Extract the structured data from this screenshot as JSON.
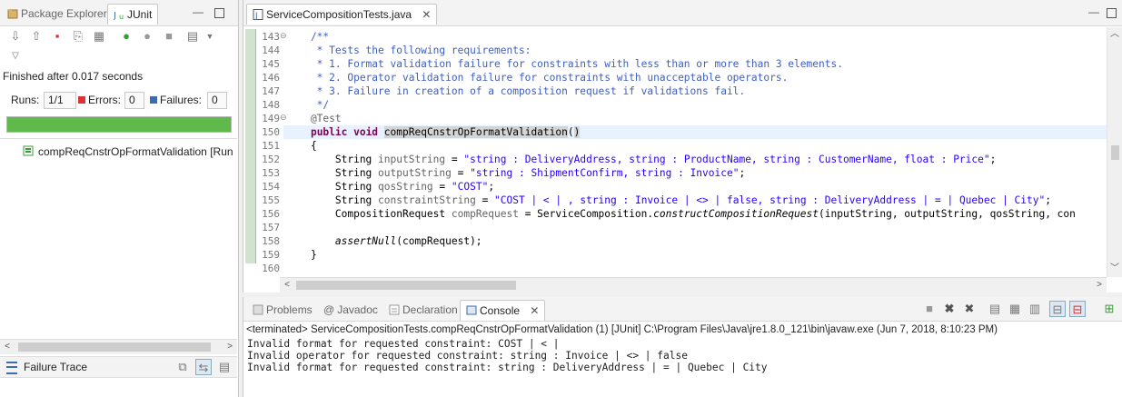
{
  "left_view": {
    "tabs": [
      {
        "label": "Package Explorer",
        "icon": "package-explorer-icon"
      },
      {
        "label": "JUnit",
        "icon": "junit-icon",
        "active": true
      }
    ],
    "status": "Finished after 0.017 seconds",
    "counters": {
      "runs_label": "Runs:",
      "runs_value": "1/1",
      "errors_label": "Errors:",
      "errors_value": "0",
      "failures_label": "Failures:",
      "failures_value": "0"
    },
    "progress": 1.0,
    "progress_color": "#5fba4b",
    "test_item": "compReqCnstrOpFormatValidation [Run",
    "failure_trace_label": "Failure Trace"
  },
  "editor": {
    "tab_label": "ServiceCompositionTests.java",
    "lines": [
      {
        "n": "143",
        "fold": "⊖",
        "parts": [
          {
            "t": "    /**",
            "c": "cmt"
          }
        ]
      },
      {
        "n": "144",
        "parts": [
          {
            "t": "     * Tests the following requirements:",
            "c": "cmt"
          }
        ]
      },
      {
        "n": "145",
        "parts": [
          {
            "t": "     * 1. Format validation failure for constraints with less than or more than 3 elements.",
            "c": "cmt"
          }
        ]
      },
      {
        "n": "146",
        "parts": [
          {
            "t": "     * 2. Operator validation failure for constraints with unacceptable operators.",
            "c": "cmt"
          }
        ]
      },
      {
        "n": "147",
        "parts": [
          {
            "t": "     * 3. Failure in creation of a composition request if validations fail.",
            "c": "cmt"
          }
        ]
      },
      {
        "n": "148",
        "parts": [
          {
            "t": "     */",
            "c": "cmt"
          }
        ]
      },
      {
        "n": "149",
        "fold": "⊖",
        "parts": [
          {
            "t": "    @Test",
            "c": "ann"
          }
        ]
      },
      {
        "n": "150",
        "current": true,
        "parts": [
          {
            "t": "    "
          },
          {
            "t": "public void",
            "c": "kw"
          },
          {
            "t": " "
          },
          {
            "t": "compReqCnstrOpFormatValidation",
            "c": "sel"
          },
          {
            "t": "("
          },
          {
            "t": ")",
            "c": "sel"
          }
        ]
      },
      {
        "n": "151",
        "parts": [
          {
            "t": "    {"
          }
        ]
      },
      {
        "n": "152",
        "parts": [
          {
            "t": "        String "
          },
          {
            "t": "inputString",
            "c": "ann"
          },
          {
            "t": " = "
          },
          {
            "t": "\"string : DeliveryAddress, string : ProductName, string : CustomerName, float : Price\"",
            "c": "str"
          },
          {
            "t": ";"
          }
        ]
      },
      {
        "n": "153",
        "parts": [
          {
            "t": "        String "
          },
          {
            "t": "outputString",
            "c": "ann"
          },
          {
            "t": " = "
          },
          {
            "t": "\"string : ShipmentConfirm, string : Invoice\"",
            "c": "str"
          },
          {
            "t": ";"
          }
        ]
      },
      {
        "n": "154",
        "parts": [
          {
            "t": "        String "
          },
          {
            "t": "qosString",
            "c": "ann"
          },
          {
            "t": " = "
          },
          {
            "t": "\"COST\"",
            "c": "str"
          },
          {
            "t": ";"
          }
        ]
      },
      {
        "n": "155",
        "parts": [
          {
            "t": "        String "
          },
          {
            "t": "constraintString",
            "c": "ann"
          },
          {
            "t": " = "
          },
          {
            "t": "\"COST | < | , string : Invoice | <> | false, string : DeliveryAddress | = | Quebec | City\"",
            "c": "str"
          },
          {
            "t": ";"
          }
        ]
      },
      {
        "n": "156",
        "parts": [
          {
            "t": "        CompositionRequest "
          },
          {
            "t": "compRequest",
            "c": "ann"
          },
          {
            "t": " = ServiceComposition."
          },
          {
            "t": "constructCompositionRequest",
            "c": "it"
          },
          {
            "t": "(inputString, outputString, qosString, con"
          }
        ]
      },
      {
        "n": "157",
        "parts": [
          {
            "t": ""
          }
        ]
      },
      {
        "n": "158",
        "parts": [
          {
            "t": "        "
          },
          {
            "t": "assertNull",
            "c": "it"
          },
          {
            "t": "(compRequest);"
          }
        ]
      },
      {
        "n": "159",
        "parts": [
          {
            "t": "    }"
          }
        ]
      },
      {
        "n": "160",
        "parts": [
          {
            "t": ""
          }
        ]
      }
    ]
  },
  "console_view": {
    "tabs": [
      {
        "label": "Problems",
        "icon": "problems-icon"
      },
      {
        "label": "Javadoc",
        "icon": "javadoc-icon"
      },
      {
        "label": "Declaration",
        "icon": "declaration-icon"
      },
      {
        "label": "Console",
        "icon": "console-icon",
        "active": true
      }
    ],
    "terminated_line": "<terminated> ServiceCompositionTests.compReqCnstrOpFormatValidation (1) [JUnit] C:\\Program Files\\Java\\jre1.8.0_121\\bin\\javaw.exe (Jun 7, 2018, 8:10:23 PM)",
    "output_lines": [
      "Invalid format for requested constraint: COST | < |",
      "Invalid operator for requested constraint: string : Invoice | <> | false",
      "Invalid format for requested constraint: string : DeliveryAddress | = | Quebec | City"
    ]
  }
}
